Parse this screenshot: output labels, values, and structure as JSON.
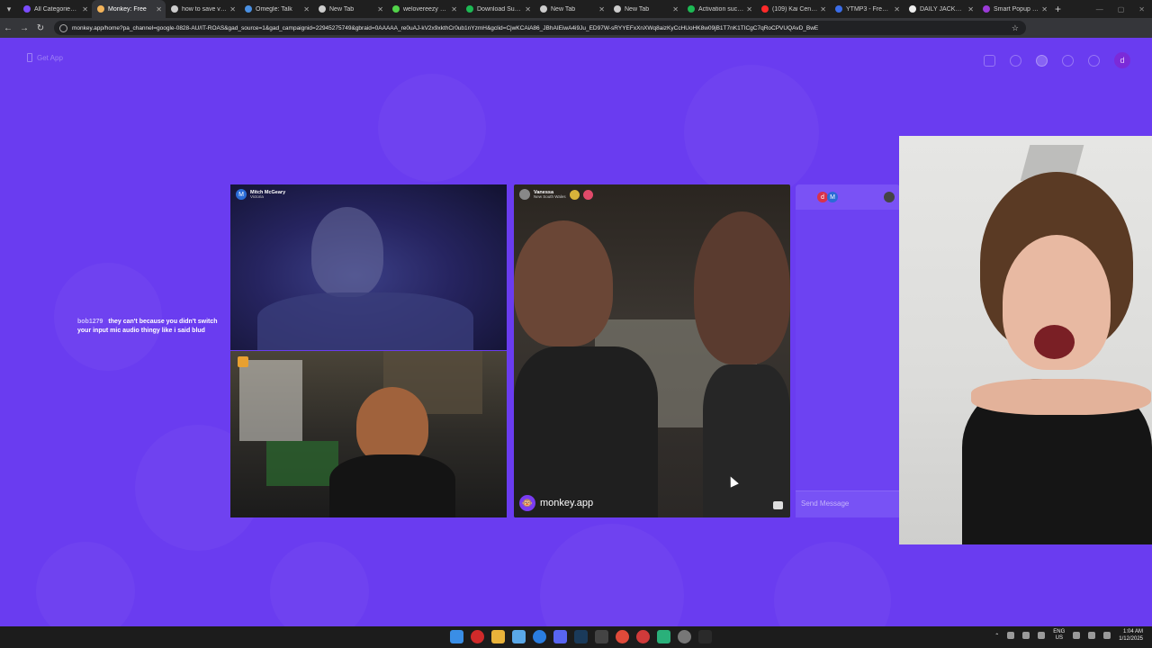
{
  "browser": {
    "tabs": [
      {
        "label": "All Categories - T",
        "color": "#7b4cff"
      },
      {
        "label": "Monkey: Free",
        "color": "#f2b35a",
        "active": true
      },
      {
        "label": "how to save vod",
        "color": "#cccccc"
      },
      {
        "label": "Omegle: Talk",
        "color": "#4a90e2"
      },
      {
        "label": "New Tab",
        "color": "#cccccc"
      },
      {
        "label": "welovereezy Stre",
        "color": "#52d34a"
      },
      {
        "label": "Download Succe",
        "color": "#1db954"
      },
      {
        "label": "New Tab",
        "color": "#cccccc"
      },
      {
        "label": "New Tab",
        "color": "#cccccc"
      },
      {
        "label": "Activation succe",
        "color": "#1db954"
      },
      {
        "label": "(109) Kai Cenat Il",
        "color": "#ff2a2a"
      },
      {
        "label": "YTMP3 - Free Yo",
        "color": "#3b6de8"
      },
      {
        "label": "DAILY JACKPOTS!",
        "color": "#eeeeee"
      },
      {
        "label": "Smart Popup Blo",
        "color": "#9b3bd8"
      }
    ],
    "url": "monkey.app/home?pa_channel=google-0828-AU/IT-ROAS&gad_source=1&gad_campaignid=22945275749&gbraid=0AAAAA_re0uAJ-kV2x9xkthCr0ub1nYzmH&gclid=CjwKCAiA86_JBhAIEiwA4i9Ju_ED97W-sRYYEFxXnXWq8aizKyCcHUoHK8w09jB1T7nK1TICgC7qRoCPVUQAvD_BwE"
  },
  "page": {
    "get_app": "Get App",
    "top_avatar": "d",
    "overlay_chat": {
      "user": "bob1279",
      "message": "they can't because you didn't switch your input mic audio thingy like i said blud"
    },
    "video_top_left": {
      "initial": "M",
      "name": "Mitch McGeary",
      "location": "Victoria"
    },
    "video_mid": {
      "name": "Vanessa",
      "location": "New South Wales",
      "brand": "monkey.app"
    },
    "chat": {
      "chip1": "d",
      "chip2": "M",
      "send_placeholder": "Send Message"
    }
  },
  "taskbar": {
    "lang_top": "ENG",
    "lang_bottom": "US",
    "time": "1:04 AM",
    "date": "1/12/2025"
  }
}
